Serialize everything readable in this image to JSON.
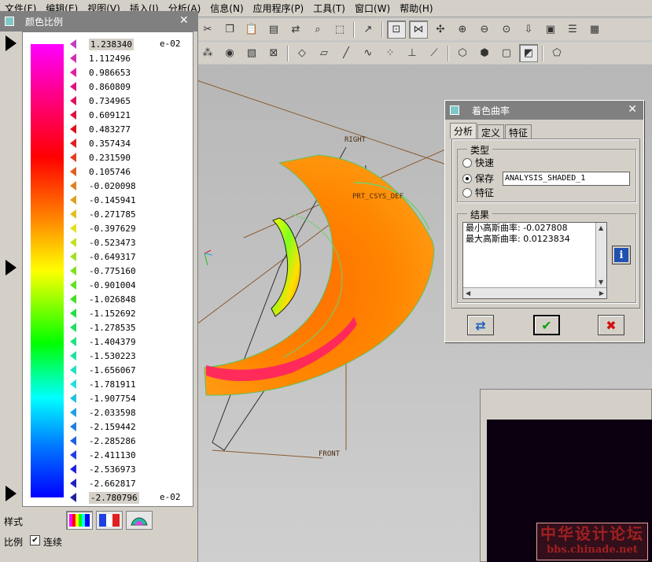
{
  "menu": {
    "items": [
      "文件(F)",
      "编辑(E)",
      "视图(V)",
      "插入(I)",
      "分析(A)",
      "信息(N)",
      "应用程序(P)",
      "工具(T)",
      "窗口(W)",
      "帮助(H)"
    ]
  },
  "toolbar1": {
    "icons": [
      "cut-icon",
      "copy-icon",
      "paste-icon",
      "paste-special-icon",
      "regenerate-icon",
      "find-icon",
      "select-box-icon",
      "annotation-icon",
      "refit-icon",
      "spin-center-icon",
      "orient-icon",
      "zoom-in-icon",
      "zoom-out-icon",
      "refit-view-icon",
      "reorient-icon",
      "saved-views-icon",
      "layers-icon",
      "model-display-icon"
    ]
  },
  "toolbar2": {
    "icons": [
      "sketch-icon",
      "datum-icon",
      "shade-icon",
      "image-icon",
      "datum-display-icon",
      "plane-display-icon",
      "axis-display-icon",
      "point-display-icon",
      "csys-display-icon",
      "spin-icon",
      "annotation-display-icon",
      "wireframe-icon",
      "hidden-line-icon",
      "no-hidden-icon",
      "shading-icon",
      "edit-icon"
    ]
  },
  "scale_window": {
    "title": "颜色比例",
    "exponent_top": "e-02",
    "exponent_bottom": "e-02",
    "values": [
      "1.238340",
      "1.112496",
      "0.986653",
      "0.860809",
      "0.734965",
      "0.609121",
      "0.483277",
      "0.357434",
      "0.231590",
      "0.105746",
      "-0.020098",
      "-0.145941",
      "-0.271785",
      "-0.397629",
      "-0.523473",
      "-0.649317",
      "-0.775160",
      "-0.901004",
      "-1.026848",
      "-1.152692",
      "-1.278535",
      "-1.404379",
      "-1.530223",
      "-1.656067",
      "-1.781911",
      "-1.907754",
      "-2.033598",
      "-2.159442",
      "-2.285286",
      "-2.411130",
      "-2.536973",
      "-2.662817",
      "-2.780796"
    ],
    "marker_colors": [
      "#c040c0",
      "#d030b0",
      "#e020a0",
      "#e01080",
      "#e01060",
      "#e01040",
      "#e01020",
      "#e02020",
      "#e04020",
      "#e06020",
      "#e08020",
      "#e0a020",
      "#e0c020",
      "#e0e020",
      "#c0e020",
      "#a0e020",
      "#80e020",
      "#60e020",
      "#40e020",
      "#20e040",
      "#20e060",
      "#20e080",
      "#20e0a0",
      "#20e0c0",
      "#20e0e0",
      "#20c0e0",
      "#20a0e0",
      "#2080e0",
      "#2060e0",
      "#2040e0",
      "#2020e0",
      "#2020c0",
      "#2020a0"
    ],
    "style_label": "样式",
    "ratio_label": "比例",
    "continuous_label": "连续",
    "continuous_checked": true
  },
  "viewport": {
    "label_right": "RIGHT",
    "label_front": "FRONT",
    "label_csys": "PRT_CSYS_DEF"
  },
  "dialog": {
    "title": "着色曲率",
    "tabs": [
      "分析",
      "定义",
      "特征"
    ],
    "type_group_title": "类型",
    "radio_quick": "快速",
    "radio_save": "保存",
    "radio_feature": "特征",
    "save_name": "ANALYSIS_SHADED_1",
    "result_group_title": "结果",
    "result_lines": [
      "最小高斯曲率: -0.027808",
      "最大高斯曲率: 0.0123834"
    ]
  },
  "watermark": {
    "line1": "中华设计论坛",
    "line2": "bbs.chinade.net"
  }
}
